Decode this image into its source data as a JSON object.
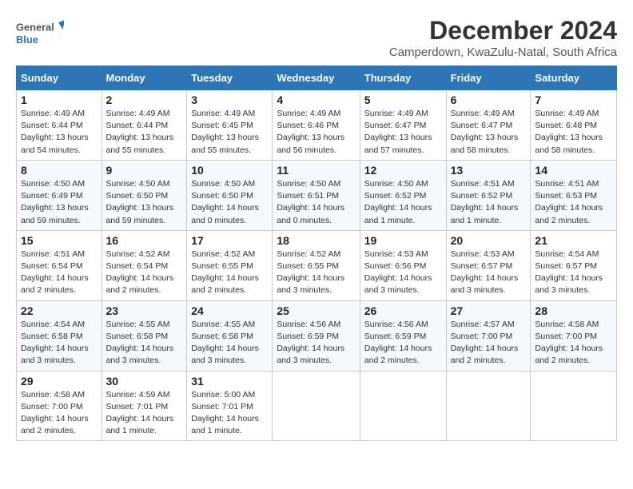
{
  "logo": {
    "text_general": "General",
    "text_blue": "Blue"
  },
  "title": "December 2024",
  "subtitle": "Camperdown, KwaZulu-Natal, South Africa",
  "days_of_week": [
    "Sunday",
    "Monday",
    "Tuesday",
    "Wednesday",
    "Thursday",
    "Friday",
    "Saturday"
  ],
  "weeks": [
    [
      {
        "day": "1",
        "sunrise": "Sunrise: 4:49 AM",
        "sunset": "Sunset: 6:44 PM",
        "daylight": "Daylight: 13 hours and 54 minutes."
      },
      {
        "day": "2",
        "sunrise": "Sunrise: 4:49 AM",
        "sunset": "Sunset: 6:44 PM",
        "daylight": "Daylight: 13 hours and 55 minutes."
      },
      {
        "day": "3",
        "sunrise": "Sunrise: 4:49 AM",
        "sunset": "Sunset: 6:45 PM",
        "daylight": "Daylight: 13 hours and 55 minutes."
      },
      {
        "day": "4",
        "sunrise": "Sunrise: 4:49 AM",
        "sunset": "Sunset: 6:46 PM",
        "daylight": "Daylight: 13 hours and 56 minutes."
      },
      {
        "day": "5",
        "sunrise": "Sunrise: 4:49 AM",
        "sunset": "Sunset: 6:47 PM",
        "daylight": "Daylight: 13 hours and 57 minutes."
      },
      {
        "day": "6",
        "sunrise": "Sunrise: 4:49 AM",
        "sunset": "Sunset: 6:47 PM",
        "daylight": "Daylight: 13 hours and 58 minutes."
      },
      {
        "day": "7",
        "sunrise": "Sunrise: 4:49 AM",
        "sunset": "Sunset: 6:48 PM",
        "daylight": "Daylight: 13 hours and 58 minutes."
      }
    ],
    [
      {
        "day": "8",
        "sunrise": "Sunrise: 4:50 AM",
        "sunset": "Sunset: 6:49 PM",
        "daylight": "Daylight: 13 hours and 59 minutes."
      },
      {
        "day": "9",
        "sunrise": "Sunrise: 4:50 AM",
        "sunset": "Sunset: 6:50 PM",
        "daylight": "Daylight: 13 hours and 59 minutes."
      },
      {
        "day": "10",
        "sunrise": "Sunrise: 4:50 AM",
        "sunset": "Sunset: 6:50 PM",
        "daylight": "Daylight: 14 hours and 0 minutes."
      },
      {
        "day": "11",
        "sunrise": "Sunrise: 4:50 AM",
        "sunset": "Sunset: 6:51 PM",
        "daylight": "Daylight: 14 hours and 0 minutes."
      },
      {
        "day": "12",
        "sunrise": "Sunrise: 4:50 AM",
        "sunset": "Sunset: 6:52 PM",
        "daylight": "Daylight: 14 hours and 1 minute."
      },
      {
        "day": "13",
        "sunrise": "Sunrise: 4:51 AM",
        "sunset": "Sunset: 6:52 PM",
        "daylight": "Daylight: 14 hours and 1 minute."
      },
      {
        "day": "14",
        "sunrise": "Sunrise: 4:51 AM",
        "sunset": "Sunset: 6:53 PM",
        "daylight": "Daylight: 14 hours and 2 minutes."
      }
    ],
    [
      {
        "day": "15",
        "sunrise": "Sunrise: 4:51 AM",
        "sunset": "Sunset: 6:54 PM",
        "daylight": "Daylight: 14 hours and 2 minutes."
      },
      {
        "day": "16",
        "sunrise": "Sunrise: 4:52 AM",
        "sunset": "Sunset: 6:54 PM",
        "daylight": "Daylight: 14 hours and 2 minutes."
      },
      {
        "day": "17",
        "sunrise": "Sunrise: 4:52 AM",
        "sunset": "Sunset: 6:55 PM",
        "daylight": "Daylight: 14 hours and 2 minutes."
      },
      {
        "day": "18",
        "sunrise": "Sunrise: 4:52 AM",
        "sunset": "Sunset: 6:55 PM",
        "daylight": "Daylight: 14 hours and 3 minutes."
      },
      {
        "day": "19",
        "sunrise": "Sunrise: 4:53 AM",
        "sunset": "Sunset: 6:56 PM",
        "daylight": "Daylight: 14 hours and 3 minutes."
      },
      {
        "day": "20",
        "sunrise": "Sunrise: 4:53 AM",
        "sunset": "Sunset: 6:57 PM",
        "daylight": "Daylight: 14 hours and 3 minutes."
      },
      {
        "day": "21",
        "sunrise": "Sunrise: 4:54 AM",
        "sunset": "Sunset: 6:57 PM",
        "daylight": "Daylight: 14 hours and 3 minutes."
      }
    ],
    [
      {
        "day": "22",
        "sunrise": "Sunrise: 4:54 AM",
        "sunset": "Sunset: 6:58 PM",
        "daylight": "Daylight: 14 hours and 3 minutes."
      },
      {
        "day": "23",
        "sunrise": "Sunrise: 4:55 AM",
        "sunset": "Sunset: 6:58 PM",
        "daylight": "Daylight: 14 hours and 3 minutes."
      },
      {
        "day": "24",
        "sunrise": "Sunrise: 4:55 AM",
        "sunset": "Sunset: 6:58 PM",
        "daylight": "Daylight: 14 hours and 3 minutes."
      },
      {
        "day": "25",
        "sunrise": "Sunrise: 4:56 AM",
        "sunset": "Sunset: 6:59 PM",
        "daylight": "Daylight: 14 hours and 3 minutes."
      },
      {
        "day": "26",
        "sunrise": "Sunrise: 4:56 AM",
        "sunset": "Sunset: 6:59 PM",
        "daylight": "Daylight: 14 hours and 2 minutes."
      },
      {
        "day": "27",
        "sunrise": "Sunrise: 4:57 AM",
        "sunset": "Sunset: 7:00 PM",
        "daylight": "Daylight: 14 hours and 2 minutes."
      },
      {
        "day": "28",
        "sunrise": "Sunrise: 4:58 AM",
        "sunset": "Sunset: 7:00 PM",
        "daylight": "Daylight: 14 hours and 2 minutes."
      }
    ],
    [
      {
        "day": "29",
        "sunrise": "Sunrise: 4:58 AM",
        "sunset": "Sunset: 7:00 PM",
        "daylight": "Daylight: 14 hours and 2 minutes."
      },
      {
        "day": "30",
        "sunrise": "Sunrise: 4:59 AM",
        "sunset": "Sunset: 7:01 PM",
        "daylight": "Daylight: 14 hours and 1 minute."
      },
      {
        "day": "31",
        "sunrise": "Sunrise: 5:00 AM",
        "sunset": "Sunset: 7:01 PM",
        "daylight": "Daylight: 14 hours and 1 minute."
      },
      null,
      null,
      null,
      null
    ]
  ]
}
